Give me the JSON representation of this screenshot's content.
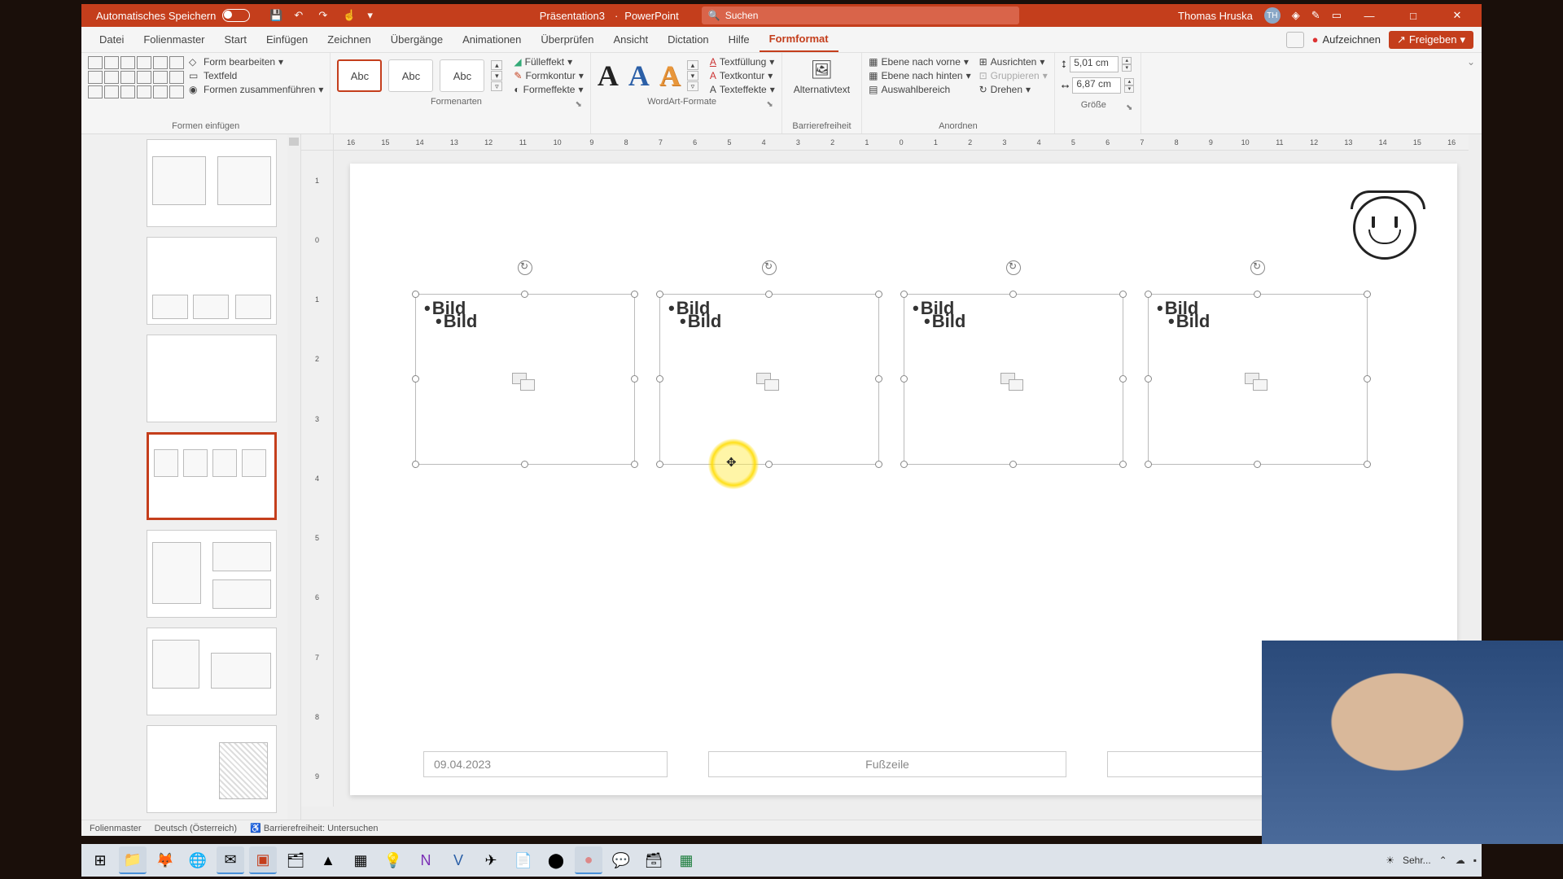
{
  "titlebar": {
    "autosave": "Automatisches Speichern",
    "doc": "Präsentation3",
    "app": "PowerPoint",
    "search_ph": "Suchen",
    "user": "Thomas Hruska",
    "initials": "TH"
  },
  "tabs": {
    "items": [
      "Datei",
      "Folienmaster",
      "Start",
      "Einfügen",
      "Zeichnen",
      "Übergänge",
      "Animationen",
      "Überprüfen",
      "Ansicht",
      "Dictation",
      "Hilfe",
      "Formformat"
    ],
    "active": 11,
    "record": "Aufzeichnen",
    "share": "Freigeben"
  },
  "ribbon": {
    "insert_shapes": "Formen einfügen",
    "edit_shape": "Form bearbeiten",
    "textbox": "Textfeld",
    "merge": "Formen zusammenführen",
    "shape_styles": "Formenarten",
    "abc": "Abc",
    "fill": "Fülleffekt",
    "outline": "Formkontur",
    "effects": "Formeffekte",
    "wordart_styles": "WordArt-Formate",
    "wa": "A",
    "text_fill": "Textfüllung",
    "text_outline": "Textkontur",
    "text_effects": "Texteffekte",
    "alt_text": "Alternativtext",
    "accessibility_grp": "Barrierefreiheit",
    "bring_fwd": "Ebene nach vorne",
    "send_back": "Ebene nach hinten",
    "selection": "Auswahlbereich",
    "align": "Ausrichten",
    "group": "Gruppieren",
    "rotate": "Drehen",
    "arrange_grp": "Anordnen",
    "size_grp": "Größe",
    "height": "5,01 cm",
    "width": "6,87 cm"
  },
  "ruler_h": [
    "16",
    "15",
    "14",
    "13",
    "12",
    "11",
    "10",
    "9",
    "8",
    "7",
    "6",
    "5",
    "4",
    "3",
    "2",
    "1",
    "0",
    "1",
    "2",
    "3",
    "4",
    "5",
    "6",
    "7",
    "8",
    "9",
    "10",
    "11",
    "12",
    "13",
    "14",
    "15",
    "16"
  ],
  "ruler_v": [
    "1",
    "0",
    "1",
    "2",
    "3",
    "4",
    "5",
    "6",
    "7",
    "8",
    "9"
  ],
  "slide": {
    "bild": "Bild",
    "date": "09.04.2023",
    "footer": "Fußzeile"
  },
  "status": {
    "master": "Folienmaster",
    "lang": "Deutsch (Österreich)",
    "access": "Barrierefreiheit: Untersuchen"
  },
  "tray": {
    "weather": "Sehr..."
  }
}
